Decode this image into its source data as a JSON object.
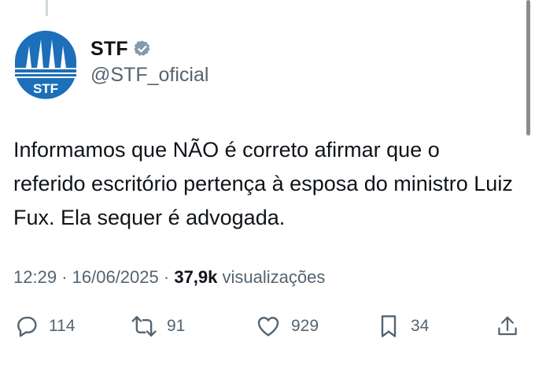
{
  "tweet": {
    "author": {
      "display_name": "STF",
      "handle": "@STF_oficial",
      "avatar_text": "STF",
      "verified": true
    },
    "text": "Informamos que NÃO é correto afirmar que o referido escritório pertença à esposa do ministro Luiz Fux. Ela sequer é advogada.",
    "time": "12:29",
    "separator": "·",
    "date": "16/06/2025",
    "views_count": "37,9k",
    "views_label": "visualizações"
  },
  "actions": {
    "replies": "114",
    "reposts": "91",
    "likes": "929",
    "bookmarks": "34"
  },
  "colors": {
    "brand_blue": "#1c6fb8",
    "text_primary": "#0f1419",
    "text_secondary": "#536471",
    "verified_badge": "#829aab"
  },
  "icons": [
    "reply-icon",
    "repost-icon",
    "like-icon",
    "bookmark-icon",
    "share-icon",
    "verified-badge-icon"
  ]
}
